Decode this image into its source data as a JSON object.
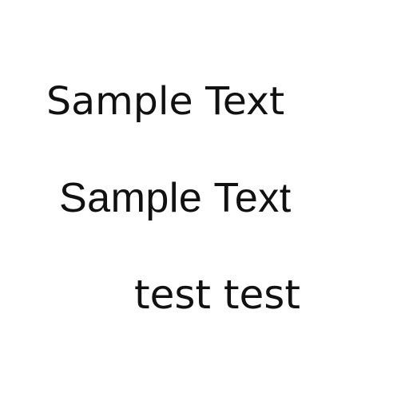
{
  "lines": [
    "Sample Text",
    "Sample Text",
    "test test"
  ],
  "text_color": "#111111",
  "background_color": "#ffffff"
}
